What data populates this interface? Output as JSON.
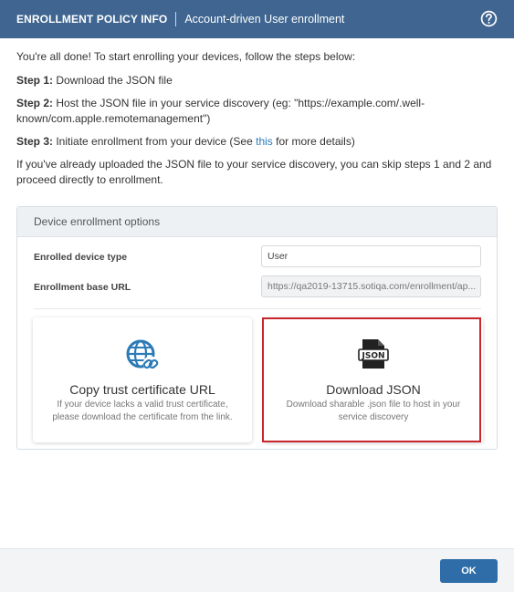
{
  "header": {
    "title": "ENROLLMENT POLICY INFO",
    "subtitle": "Account-driven User enrollment",
    "help_icon": "question-circle-icon"
  },
  "intro": {
    "text": "You're all done! To start enrolling your devices, follow the steps below:"
  },
  "steps": [
    {
      "label": "Step 1:",
      "text": " Download the JSON file"
    },
    {
      "label": "Step 2:",
      "text": " Host the JSON file in your service discovery (eg: \"https://example.com/.well-known/com.apple.remotemanagement\")"
    },
    {
      "label": "Step 3:",
      "text_before": " Initiate enrollment from your device (See ",
      "link": "this",
      "text_after": " for more details)"
    }
  ],
  "note": {
    "text": "If you've already uploaded the JSON file to your service discovery, you can skip steps 1 and 2 and proceed directly to enrollment."
  },
  "panel": {
    "title": "Device enrollment options",
    "device_type": {
      "label": "Enrolled device type",
      "value": "User"
    },
    "base_url": {
      "label": "Enrollment base URL",
      "value": "https://qa2019-13715.sotiqa.com/enrollment/ap..."
    }
  },
  "cards": {
    "copy": {
      "icon": "globe-link-icon",
      "title": "Copy trust certificate URL",
      "description": "If your device lacks a valid trust certificate, please download the certificate from the link."
    },
    "download": {
      "icon": "json-file-icon",
      "title": "Download JSON",
      "description": "Download sharable .json file to host in your service discovery"
    }
  },
  "footer": {
    "ok_label": "OK"
  },
  "colors": {
    "header_bg": "#3f6590",
    "accent": "#2f6da8",
    "highlight": "#c9262c"
  }
}
